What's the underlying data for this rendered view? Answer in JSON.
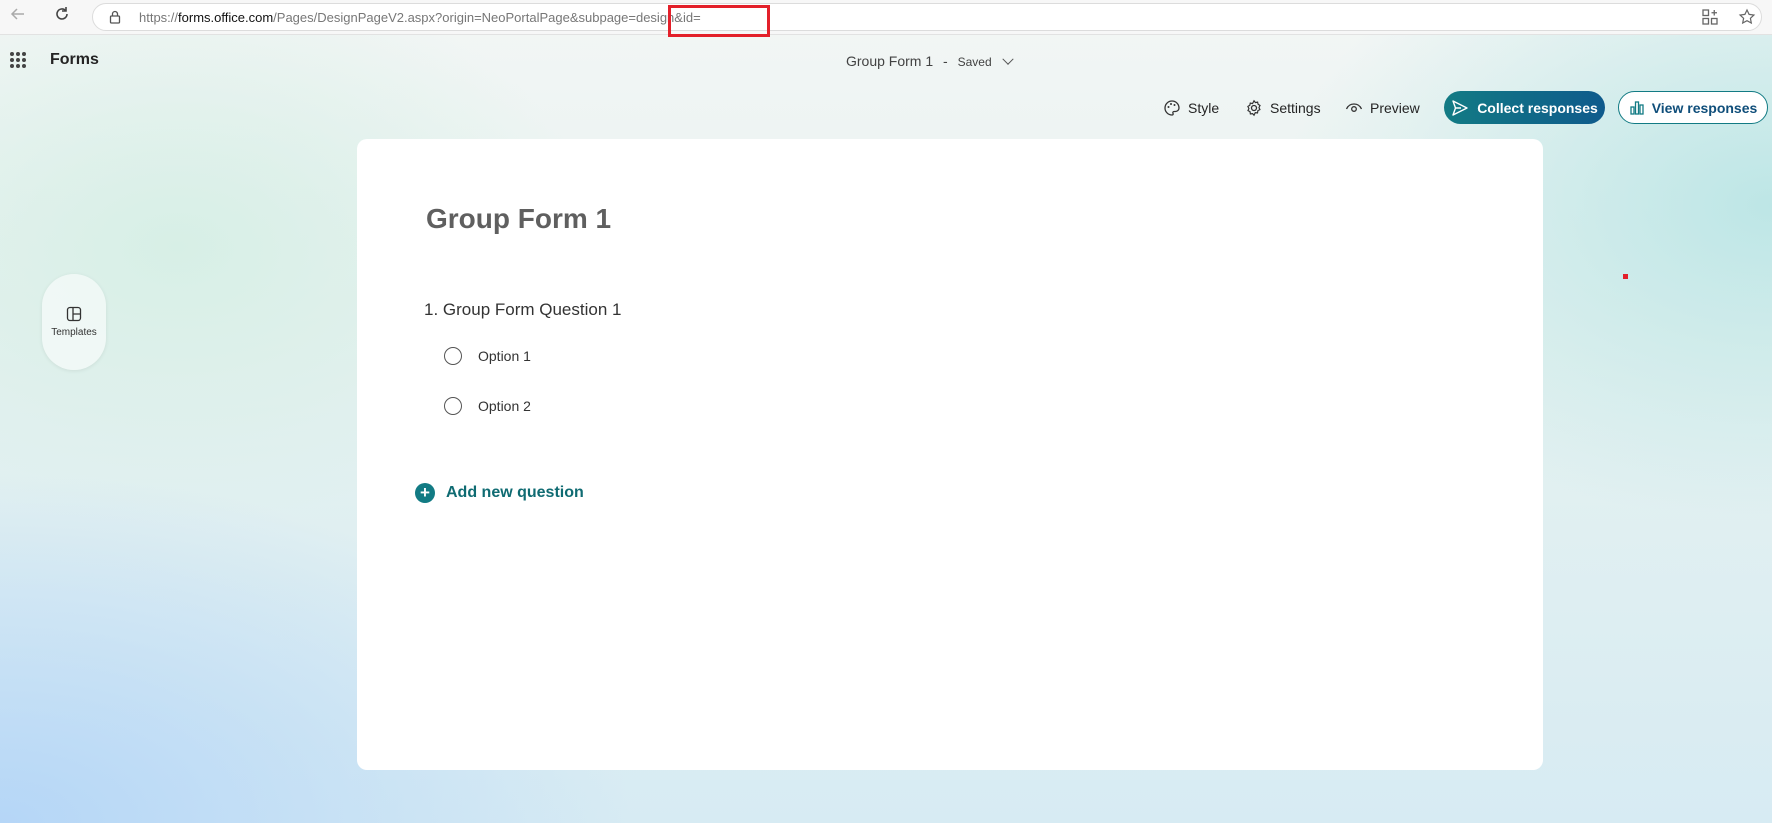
{
  "browser": {
    "url_prefix": "https://",
    "url_host": "forms.office.com",
    "url_path": "/Pages/DesignPageV2.aspx?origin=NeoPortalPage&subpage=design&id="
  },
  "header": {
    "app_name": "Forms",
    "doc_title": "Group Form 1",
    "separator": "-",
    "status": "Saved"
  },
  "toolbar": {
    "style_label": "Style",
    "settings_label": "Settings",
    "preview_label": "Preview",
    "collect_label": "Collect responses",
    "view_label": "View responses"
  },
  "sidebar": {
    "templates_label": "Templates"
  },
  "form": {
    "title": "Group Form 1",
    "questions": [
      {
        "title": "1. Group Form Question 1",
        "options": [
          "Option 1",
          "Option 2"
        ]
      }
    ],
    "add_question_label": "Add new question"
  },
  "colors": {
    "accent": "#127b84",
    "highlight": "#e3202a"
  }
}
